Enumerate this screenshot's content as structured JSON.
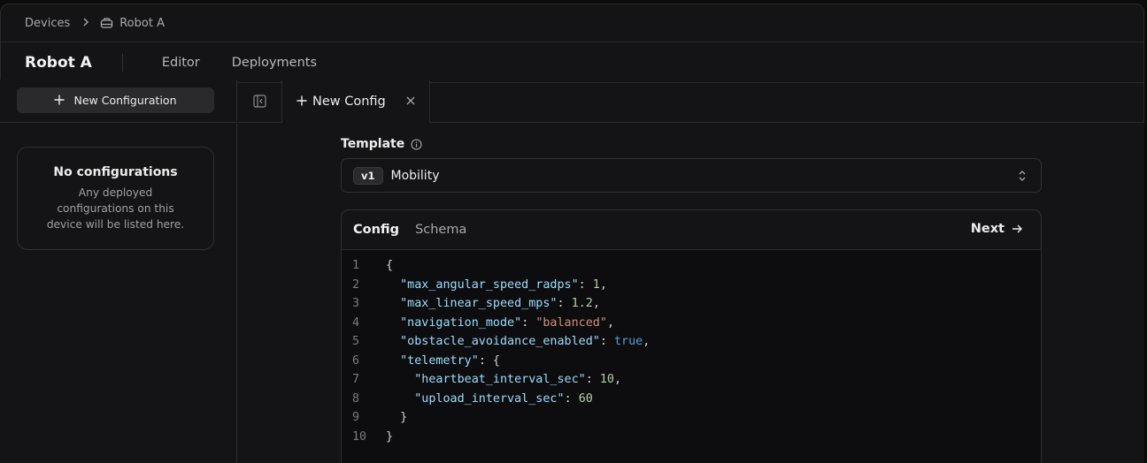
{
  "breadcrumb": {
    "root": "Devices",
    "current": "Robot A"
  },
  "header": {
    "title": "Robot A",
    "nav": [
      "Editor",
      "Deployments"
    ]
  },
  "sidebar": {
    "new_button": "New Configuration",
    "empty_title": "No configurations",
    "empty_text": "Any deployed configurations on this device will be listed here."
  },
  "tabs": {
    "active_label": "New Config"
  },
  "template": {
    "label": "Template",
    "version_badge": "v1",
    "value": "Mobility"
  },
  "editor": {
    "tabs": [
      "Config",
      "Schema"
    ],
    "next_label": "Next",
    "lines": [
      {
        "n": "1",
        "tokens": [
          [
            "pn",
            "{"
          ]
        ]
      },
      {
        "n": "2",
        "tokens": [
          [
            "pn",
            "  "
          ],
          [
            "k",
            "\"max_angular_speed_radps\""
          ],
          [
            "pn",
            ": "
          ],
          [
            "n",
            "1"
          ],
          [
            "pn",
            ","
          ]
        ]
      },
      {
        "n": "3",
        "tokens": [
          [
            "pn",
            "  "
          ],
          [
            "k",
            "\"max_linear_speed_mps\""
          ],
          [
            "pn",
            ": "
          ],
          [
            "n",
            "1.2"
          ],
          [
            "pn",
            ","
          ]
        ]
      },
      {
        "n": "4",
        "tokens": [
          [
            "pn",
            "  "
          ],
          [
            "k",
            "\"navigation_mode\""
          ],
          [
            "pn",
            ": "
          ],
          [
            "s",
            "\"balanced\""
          ],
          [
            "pn",
            ","
          ]
        ]
      },
      {
        "n": "5",
        "tokens": [
          [
            "pn",
            "  "
          ],
          [
            "k",
            "\"obstacle_avoidance_enabled\""
          ],
          [
            "pn",
            ": "
          ],
          [
            "b",
            "true"
          ],
          [
            "pn",
            ","
          ]
        ]
      },
      {
        "n": "6",
        "tokens": [
          [
            "pn",
            "  "
          ],
          [
            "k",
            "\"telemetry\""
          ],
          [
            "pn",
            ": {"
          ]
        ]
      },
      {
        "n": "7",
        "tokens": [
          [
            "pn",
            "    "
          ],
          [
            "k",
            "\"heartbeat_interval_sec\""
          ],
          [
            "pn",
            ": "
          ],
          [
            "n",
            "10"
          ],
          [
            "pn",
            ","
          ]
        ]
      },
      {
        "n": "8",
        "tokens": [
          [
            "pn",
            "    "
          ],
          [
            "k",
            "\"upload_interval_sec\""
          ],
          [
            "pn",
            ": "
          ],
          [
            "n",
            "60"
          ]
        ]
      },
      {
        "n": "9",
        "tokens": [
          [
            "pn",
            "  }"
          ]
        ]
      },
      {
        "n": "10",
        "tokens": [
          [
            "pn",
            "}"
          ]
        ]
      }
    ]
  },
  "icons": {
    "breadcrumb_sep": "chevron-right-icon",
    "robot": "robot-icon",
    "plus": "plus-icon",
    "collapse": "sidebar-collapse-icon",
    "close": "close-icon",
    "info": "info-icon",
    "select": "chevron-up-down-icon",
    "next": "arrow-right-icon"
  }
}
